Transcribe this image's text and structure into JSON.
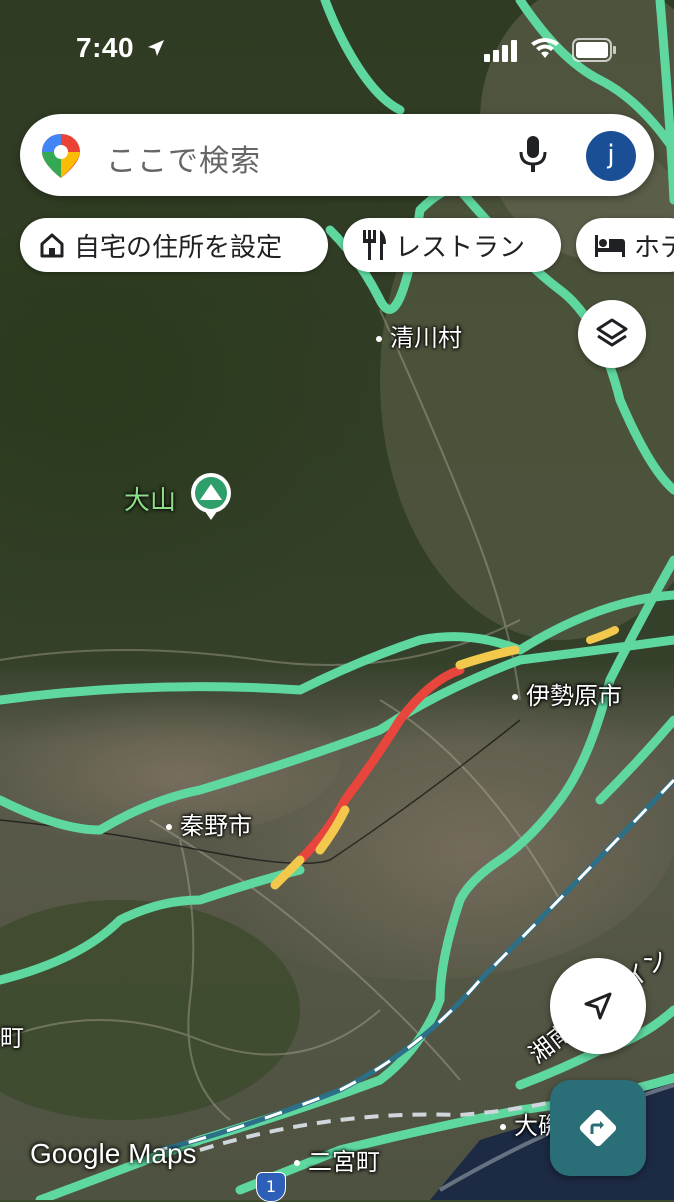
{
  "status_bar": {
    "time": "7:40"
  },
  "search": {
    "placeholder": "ここで検索",
    "avatar_initial": "j"
  },
  "chips": [
    {
      "label": "自宅の住所を設定",
      "icon": "home-icon"
    },
    {
      "label": "レストラン",
      "icon": "restaurant-icon"
    },
    {
      "label": "ホテ",
      "icon": "hotel-icon"
    }
  ],
  "map_labels": {
    "kiyokawa": "清川村",
    "oyama": "大山",
    "isehara": "伊勢原市",
    "hadano": "秦野市",
    "ninomiya": "二宮町",
    "oiso": "大磯",
    "shonan_line": "湘南新宿ライン",
    "left_edge": "町"
  },
  "route_shield": "1",
  "brand": "Google Maps",
  "colors": {
    "traffic_green": "#5fd8a0",
    "traffic_red": "#e8453c",
    "traffic_yellow": "#f2c94c",
    "avatar": "#1a4f96",
    "directions_button": "#2a6e78"
  }
}
